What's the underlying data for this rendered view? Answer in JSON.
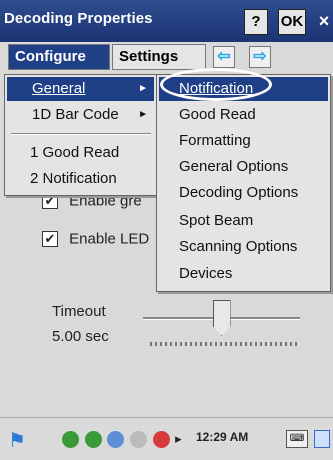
{
  "window": {
    "title": "Decoding Properties",
    "help_label": "?",
    "ok_label": "OK",
    "close_label": "×"
  },
  "tabs": {
    "configure": "Configure",
    "settings": "Settings",
    "scroll_left": "⇦",
    "scroll_right": "⇨"
  },
  "main_menu": {
    "items": [
      {
        "label": "General",
        "has_submenu": true,
        "selected": true
      },
      {
        "label": "1D Bar Code",
        "has_submenu": true,
        "selected": false
      },
      {
        "label": "1 Good Read",
        "has_submenu": false,
        "selected": false
      },
      {
        "label": "2 Notification",
        "has_submenu": false,
        "selected": false
      }
    ],
    "submenu_arrow": "►"
  },
  "submenu": {
    "items": [
      {
        "label": "Notification",
        "highlighted": true
      },
      {
        "label": "Good Read"
      },
      {
        "label": "Formatting"
      },
      {
        "label": "General Options"
      },
      {
        "label": "Decoding Options"
      },
      {
        "label": "Spot Beam"
      },
      {
        "label": "Scanning Options"
      },
      {
        "label": "Devices"
      }
    ]
  },
  "background": {
    "check1_label": "Enable gre",
    "check2_label": "Enable LED",
    "check_mark": "✔",
    "timeout_label": "Timeout",
    "timeout_value": "5.00 sec",
    "timeout_fraction": 0.5
  },
  "taskbar": {
    "start_icon": "⚑",
    "tray_arrow": "▸",
    "clock": "12:29 AM",
    "keyboard_label": "⌨"
  },
  "colors": {
    "title_bar": "#1f3f86",
    "selected": "#1f3f86",
    "arrow_buttons": "#1fa9e0"
  }
}
